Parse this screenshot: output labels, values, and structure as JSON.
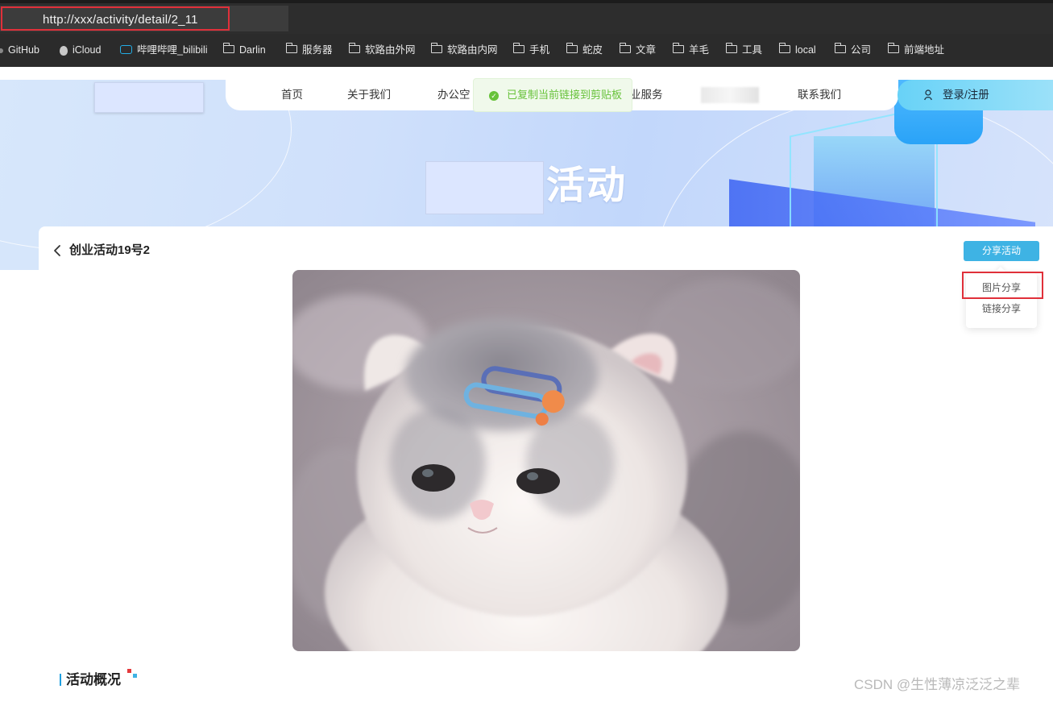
{
  "browser": {
    "url": "http://xxx/activity/detail/2_11",
    "bookmarks": [
      "GitHub",
      "iCloud",
      "哔哩哔哩_bilibili",
      "Darlin",
      "服务器",
      "软路由外网",
      "软路由内网",
      "手机",
      "蛇皮",
      "文章",
      "羊毛",
      "工具",
      "local",
      "公司",
      "前端地址"
    ]
  },
  "nav": {
    "items": [
      "首页",
      "关于我们",
      "办公空",
      "业服务",
      "联系我们"
    ],
    "login": "登录/注册"
  },
  "toast": {
    "text": "已复制当前链接到剪贴板",
    "color": "#67c23a"
  },
  "banner": {
    "title": "活动"
  },
  "detail": {
    "title": "创业活动19号2",
    "share_button": "分享活动",
    "share_menu": [
      "图片分享",
      "链接分享"
    ]
  },
  "section": {
    "title": "活动概况"
  },
  "watermark": "CSDN @生性薄凉泛泛之辈",
  "colors": {
    "accent": "#3eb3e4",
    "highlight_box": "#e0303a"
  }
}
